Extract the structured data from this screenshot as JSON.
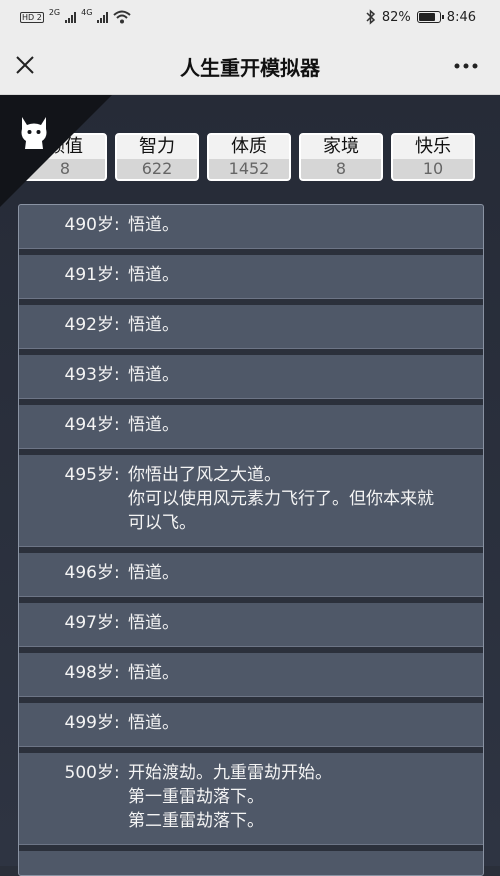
{
  "status_bar": {
    "network1": "2G",
    "network2": "4G",
    "hd": "HD 2",
    "battery_percent": "82%",
    "battery_level": 0.82,
    "time": "8:46"
  },
  "header": {
    "title": "人生重开模拟器"
  },
  "stats": [
    {
      "label": "颜值",
      "value": "8"
    },
    {
      "label": "智力",
      "value": "622"
    },
    {
      "label": "体质",
      "value": "1452"
    },
    {
      "label": "家境",
      "value": "8"
    },
    {
      "label": "快乐",
      "value": "10"
    }
  ],
  "log": [
    {
      "age": "490岁",
      "text": "悟道。"
    },
    {
      "age": "491岁",
      "text": "悟道。"
    },
    {
      "age": "492岁",
      "text": "悟道。"
    },
    {
      "age": "493岁",
      "text": "悟道。"
    },
    {
      "age": "494岁",
      "text": "悟道。"
    },
    {
      "age": "495岁",
      "text": "你悟出了风之大道。\n你可以使用风元素力飞行了。但你本来就\n可以飞。"
    },
    {
      "age": "496岁",
      "text": "悟道。"
    },
    {
      "age": "497岁",
      "text": "悟道。"
    },
    {
      "age": "498岁",
      "text": "悟道。"
    },
    {
      "age": "499岁",
      "text": "悟道。"
    },
    {
      "age": "500岁",
      "text": "开始渡劫。九重雷劫开始。\n第一重雷劫落下。\n第二重雷劫落下。"
    }
  ],
  "colors": {
    "panel": "#4f5868",
    "background": "#2a2f3a",
    "corner": "#121419"
  }
}
